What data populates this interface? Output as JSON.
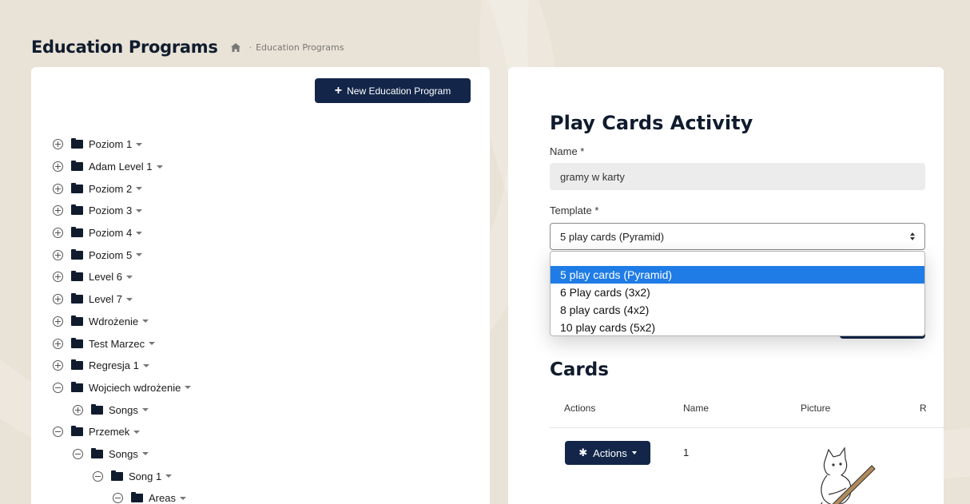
{
  "header": {
    "title": "Education Programs",
    "breadcrumb_current": "Education Programs",
    "breadcrumb_sep": "·"
  },
  "left_panel": {
    "new_button_label": "New Education Program",
    "tree": [
      {
        "label": "Poziom 1",
        "level": 0,
        "state": "collapsed"
      },
      {
        "label": "Adam Level 1",
        "level": 0,
        "state": "collapsed"
      },
      {
        "label": "Poziom 2",
        "level": 0,
        "state": "collapsed"
      },
      {
        "label": "Poziom 3",
        "level": 0,
        "state": "collapsed"
      },
      {
        "label": "Poziom 4",
        "level": 0,
        "state": "collapsed"
      },
      {
        "label": "Poziom 5",
        "level": 0,
        "state": "collapsed"
      },
      {
        "label": "Level 6",
        "level": 0,
        "state": "collapsed"
      },
      {
        "label": "Level 7",
        "level": 0,
        "state": "collapsed"
      },
      {
        "label": "Wdrożenie",
        "level": 0,
        "state": "collapsed"
      },
      {
        "label": "Test Marzec",
        "level": 0,
        "state": "collapsed"
      },
      {
        "label": "Regresja 1",
        "level": 0,
        "state": "collapsed"
      },
      {
        "label": "Wojciech wdrożenie",
        "level": 0,
        "state": "expanded"
      },
      {
        "label": "Songs",
        "level": 1,
        "state": "collapsed"
      },
      {
        "label": "Przemek",
        "level": 0,
        "state": "expanded"
      },
      {
        "label": "Songs",
        "level": 1,
        "state": "expanded"
      },
      {
        "label": "Song 1",
        "level": 2,
        "state": "expanded"
      },
      {
        "label": "Areas",
        "level": 3,
        "state": "expanded"
      }
    ]
  },
  "right_panel": {
    "title": "Play Cards Activity",
    "name_label": "Name *",
    "name_value": "gramy w karty",
    "template_label": "Template *",
    "template_value": "5 play cards (Pyramid)",
    "template_options": [
      {
        "label": "5 play cards (Pyramid)",
        "selected": true
      },
      {
        "label": "6 Play cards (3x2)",
        "selected": false
      },
      {
        "label": "8 play cards (4x2)",
        "selected": false
      },
      {
        "label": "10 play cards (5x2)",
        "selected": false
      }
    ],
    "cards_title": "Cards",
    "columns": [
      "Actions",
      "Name",
      "Picture",
      "R"
    ],
    "rows": [
      {
        "actions_label": "Actions",
        "name": "1"
      }
    ]
  },
  "colors": {
    "navy": "#13264a",
    "select_highlight": "#1f7ce6",
    "background": "#e9e2d6"
  },
  "icons": {
    "home": "home-icon",
    "folder": "folder-icon",
    "plus": "plus-icon",
    "gear": "gear-icon"
  }
}
